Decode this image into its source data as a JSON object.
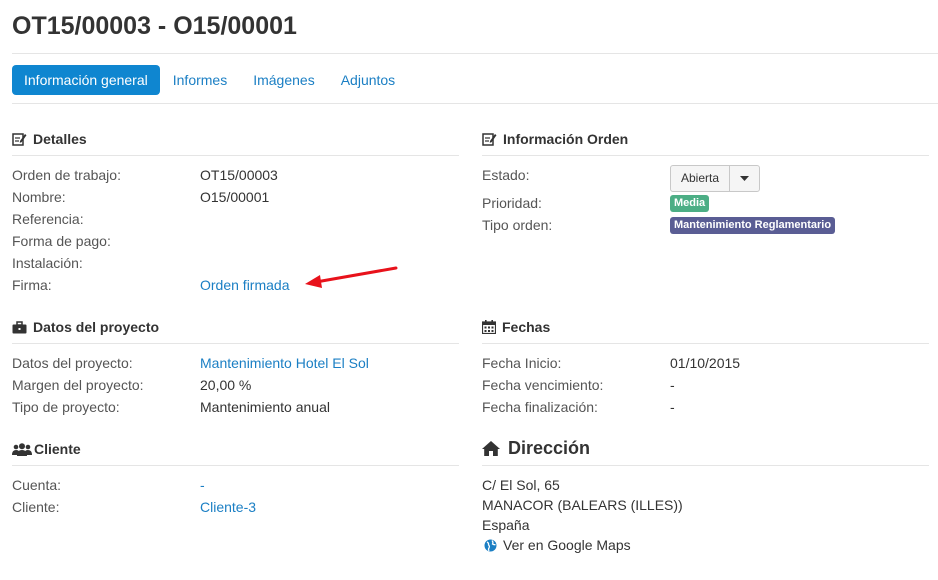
{
  "title": "OT15/00003 - O15/00001",
  "tabs": [
    "Información general",
    "Informes",
    "Imágenes",
    "Adjuntos"
  ],
  "detalles": {
    "title": "Detalles",
    "rows": [
      {
        "label": "Orden de trabajo:",
        "value": "OT15/00003"
      },
      {
        "label": "Nombre:",
        "value": "O15/00001"
      },
      {
        "label": "Referencia:",
        "value": ""
      },
      {
        "label": "Forma de pago:",
        "value": ""
      },
      {
        "label": "Instalación:",
        "value": ""
      },
      {
        "label": "Firma:",
        "value": "Orden firmada"
      }
    ]
  },
  "info_orden": {
    "title": "Información Orden",
    "estado_label": "Estado:",
    "estado_value": "Abierta",
    "prioridad_label": "Prioridad:",
    "prioridad_value": "Media",
    "tipo_label": "Tipo orden:",
    "tipo_value": "Mantenimiento Reglamentario"
  },
  "proyecto": {
    "title": "Datos del proyecto",
    "rows": [
      {
        "label": "Datos del proyecto:",
        "value": "Mantenimiento Hotel El Sol"
      },
      {
        "label": "Margen del proyecto:",
        "value": "20,00 %"
      },
      {
        "label": "Tipo de proyecto:",
        "value": "Mantenimiento anual"
      }
    ]
  },
  "fechas": {
    "title": "Fechas",
    "rows": [
      {
        "label": "Fecha Inicio:",
        "value": "01/10/2015"
      },
      {
        "label": "Fecha vencimiento:",
        "value": "-"
      },
      {
        "label": "Fecha finalización:",
        "value": "-"
      }
    ]
  },
  "cliente": {
    "title": "Cliente",
    "rows": [
      {
        "label": "Cuenta:",
        "value": "-"
      },
      {
        "label": "Cliente:",
        "value": "Cliente-3"
      }
    ]
  },
  "direccion": {
    "title": "Dirección",
    "line1": "C/ El Sol, 65",
    "line2": "MANACOR (BALEARS (ILLES))",
    "line3": "España",
    "maps_link": "Ver en Google Maps"
  },
  "colors": {
    "accent": "#0f86d0",
    "link": "#1b7fc4",
    "badge_media": "#4cae85",
    "badge_tipo": "#5a5d94",
    "annotation_arrow": "#e8121b"
  },
  "icons": [
    "edit-icon",
    "briefcase-icon",
    "users-icon",
    "calendar-icon",
    "home-icon",
    "globe-icon",
    "caret-down-icon"
  ]
}
